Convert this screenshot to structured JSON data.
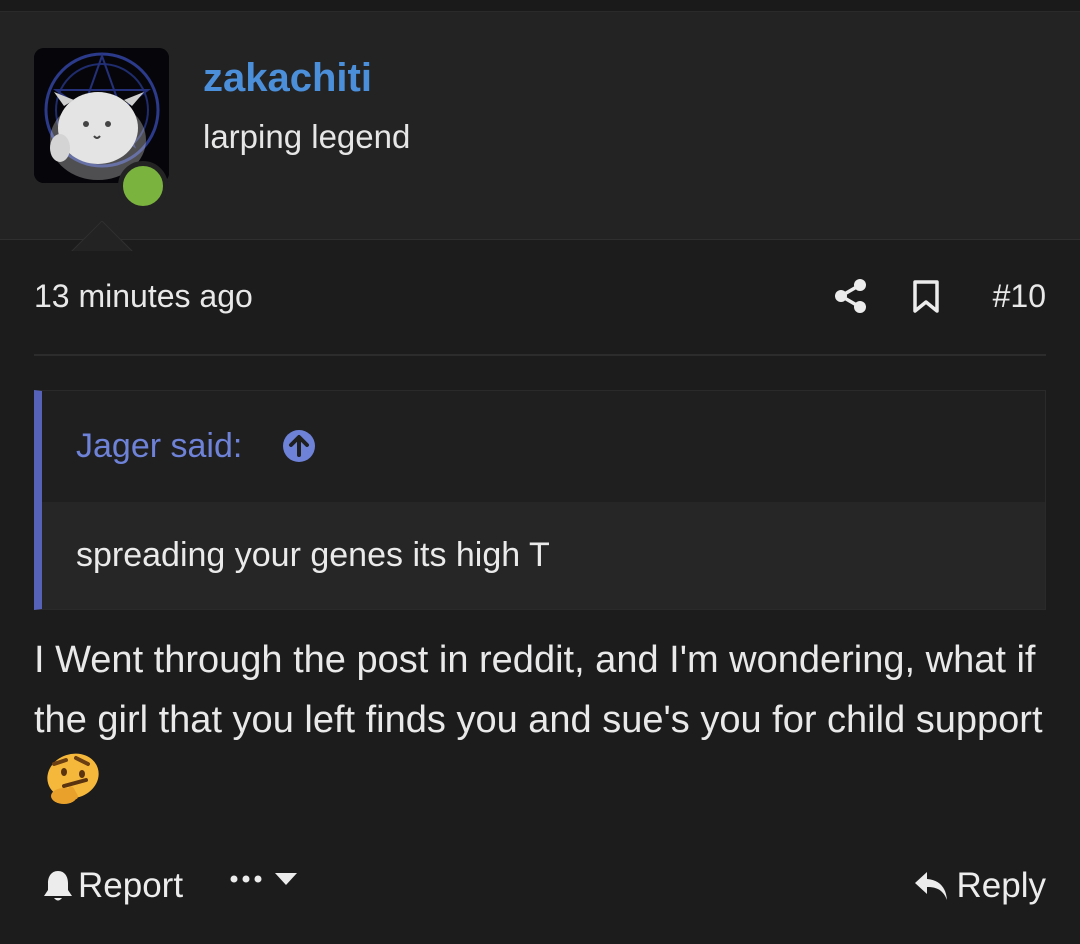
{
  "post": {
    "username": "zakachiti",
    "user_title": "larping legend",
    "online": true,
    "timestamp": "13 minutes ago",
    "post_number": "#10",
    "quote": {
      "author": "Jager said:",
      "text": "spreading your genes its high T"
    },
    "message": "I Went through the post in reddit, and I'm wondering, what if the girl that you left finds you and sue's you for child support",
    "emoji": "thinking-face-emoji"
  },
  "actions": {
    "report_label": "Report",
    "reply_label": "Reply"
  },
  "icons": {
    "share": "share-icon",
    "bookmark": "bookmark-icon",
    "quote_jump": "arrow-up-circle-icon",
    "report": "bell-icon",
    "more": "ellipsis-icon",
    "more_toggle": "caret-down-icon",
    "reply": "reply-arrow-icon"
  },
  "colors": {
    "background": "#1c1c1d",
    "header_bg": "#232324",
    "username": "#4b8fdb",
    "online": "#7ab33e",
    "quote_accent": "#5562b8",
    "quote_author": "#6e82d8"
  }
}
